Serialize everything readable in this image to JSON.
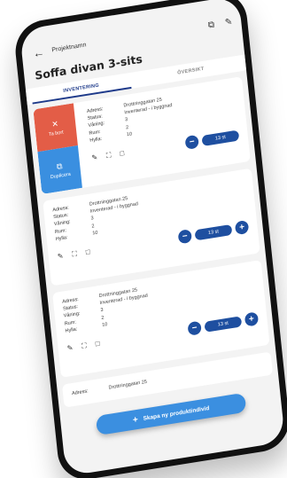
{
  "header": {
    "project_name": "Projektnamn",
    "title": "Soffa divan 3-sits"
  },
  "icons": {
    "back": "arrow-left-icon",
    "copy": "copy-icon",
    "edit": "pencil-icon",
    "scan": "scan-icon",
    "comment": "comment-icon"
  },
  "tabs": [
    {
      "label": "INVENTERING",
      "active": true
    },
    {
      "label": "ÖVERSIKT",
      "active": false
    }
  ],
  "labels": {
    "address": "Adress:",
    "status": "Status:",
    "floor": "Våning:",
    "room": "Rum:",
    "shelf": "Hylla:"
  },
  "swipe_actions": {
    "remove": "Ta bort",
    "duplicate": "Duplicera"
  },
  "items": [
    {
      "address": "Drottninggatan 25",
      "status": "Inventerad - i byggnad",
      "floor": "3",
      "room": "2",
      "shelf": "10",
      "qty": "13 st"
    },
    {
      "address": "Drottninggatan 25",
      "status": "Inventerad - i byggnad",
      "floor": "3",
      "room": "2",
      "shelf": "10",
      "qty": "13 st"
    },
    {
      "address": "Drottninggatan 25",
      "status": "Inventerad - i byggnad",
      "floor": "3",
      "room": "2",
      "shelf": "10",
      "qty": "13 st"
    },
    {
      "address": "Drottninggatan 25"
    }
  ],
  "fab": {
    "label": "Skapa ny produktindivid"
  },
  "colors": {
    "primary": "#1e4fa0",
    "danger": "#e35d47",
    "accent": "#3a8fe0"
  }
}
